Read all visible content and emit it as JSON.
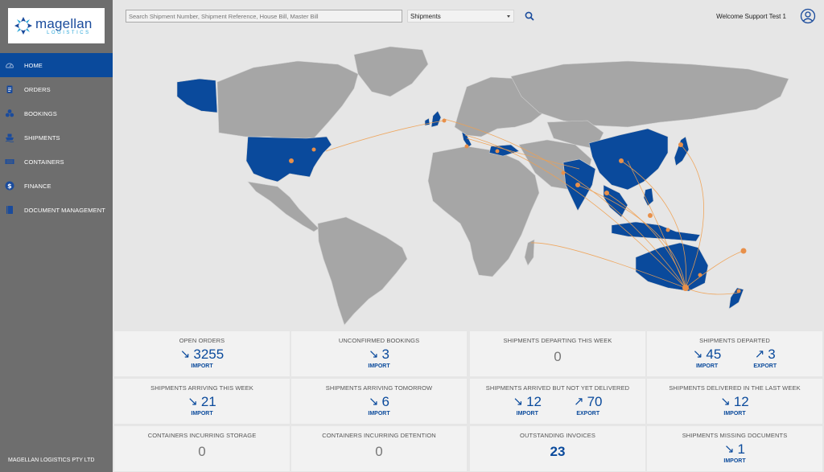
{
  "brand": {
    "name": "magellan",
    "tagline": "LOGISTICS"
  },
  "nav": [
    {
      "label": "HOME",
      "icon": "dashboard-icon",
      "active": true
    },
    {
      "label": "ORDERS",
      "icon": "clipboard-icon"
    },
    {
      "label": "BOOKINGS",
      "icon": "boxes-icon"
    },
    {
      "label": "SHIPMENTS",
      "icon": "ship-icon"
    },
    {
      "label": "CONTAINERS",
      "icon": "container-icon"
    },
    {
      "label": "FINANCE",
      "icon": "dollar-icon"
    },
    {
      "label": "DOCUMENT MANAGEMENT",
      "icon": "book-icon"
    }
  ],
  "footer": "MAGELLAN LOGISTICS PTY LTD",
  "header": {
    "search_placeholder": "Search Shipment Number, Shipment Reference, House Bill, Master Bill",
    "select_value": "Shipments",
    "welcome": "Welcome Support Test 1"
  },
  "colors": {
    "accent": "#0a4a9c",
    "sidebar": "#6e6e6e",
    "route": "#f0a050",
    "highlight_country": "#0a4a9c",
    "land": "#a6a6a6"
  },
  "tiles": [
    {
      "title": "OPEN ORDERS",
      "metrics": [
        {
          "value": "3255",
          "label": "IMPORT",
          "dir": "in"
        }
      ]
    },
    {
      "title": "UNCONFIRMED BOOKINGS",
      "metrics": [
        {
          "value": "3",
          "label": "IMPORT",
          "dir": "in"
        }
      ]
    },
    {
      "title": "SHIPMENTS DEPARTING THIS WEEK",
      "zero": "0"
    },
    {
      "title": "SHIPMENTS DEPARTED",
      "metrics": [
        {
          "value": "45",
          "label": "IMPORT",
          "dir": "in"
        },
        {
          "value": "3",
          "label": "EXPORT",
          "dir": "out"
        }
      ]
    },
    {
      "title": "SHIPMENTS ARRIVING THIS WEEK",
      "metrics": [
        {
          "value": "21",
          "label": "IMPORT",
          "dir": "in"
        }
      ]
    },
    {
      "title": "SHIPMENTS ARRIVING TOMORROW",
      "metrics": [
        {
          "value": "6",
          "label": "IMPORT",
          "dir": "in"
        }
      ]
    },
    {
      "title": "SHIPMENTS ARRIVED BUT NOT YET DELIVERED",
      "metrics": [
        {
          "value": "12",
          "label": "IMPORT",
          "dir": "in"
        },
        {
          "value": "70",
          "label": "EXPORT",
          "dir": "out"
        }
      ]
    },
    {
      "title": "SHIPMENTS DELIVERED IN THE LAST WEEK",
      "metrics": [
        {
          "value": "12",
          "label": "IMPORT",
          "dir": "in"
        }
      ]
    },
    {
      "title": "CONTAINERS INCURRING STORAGE",
      "zero": "0"
    },
    {
      "title": "CONTAINERS INCURRING DETENTION",
      "zero": "0"
    },
    {
      "title": "OUTSTANDING INVOICES",
      "big": "23"
    },
    {
      "title": "SHIPMENTS MISSING DOCUMENTS",
      "metrics": [
        {
          "value": "1",
          "label": "IMPORT",
          "dir": "in"
        }
      ]
    }
  ]
}
